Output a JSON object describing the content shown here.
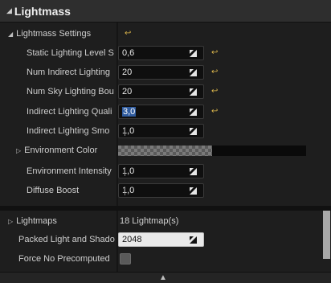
{
  "category": {
    "title": "Lightmass"
  },
  "settings_header": {
    "label": "Lightmass Settings"
  },
  "rows": [
    {
      "label": "Static Lighting Level S",
      "value": "0,6"
    },
    {
      "label": "Num Indirect Lighting",
      "value": "20"
    },
    {
      "label": "Num Sky Lighting Bou",
      "value": "20"
    },
    {
      "label": "Indirect Lighting Quali",
      "value": "3,0"
    },
    {
      "label": "Indirect Lighting Smo",
      "value": "1,0"
    }
  ],
  "environment_color": {
    "label": "Environment Color"
  },
  "rows2": [
    {
      "label": "Environment Intensity",
      "value": "1,0"
    },
    {
      "label": "Diffuse Boost",
      "value": "1,0"
    }
  ],
  "lightmaps": {
    "label": "Lightmaps",
    "value": "18 Lightmap(s)"
  },
  "packed": {
    "label": "Packed Light and Shado",
    "value": "2048"
  },
  "force_no_precomputed": {
    "label": "Force No Precomputed"
  },
  "colors": {
    "accent_reset": "#d6b24a",
    "selection": "#2f5b9e"
  }
}
